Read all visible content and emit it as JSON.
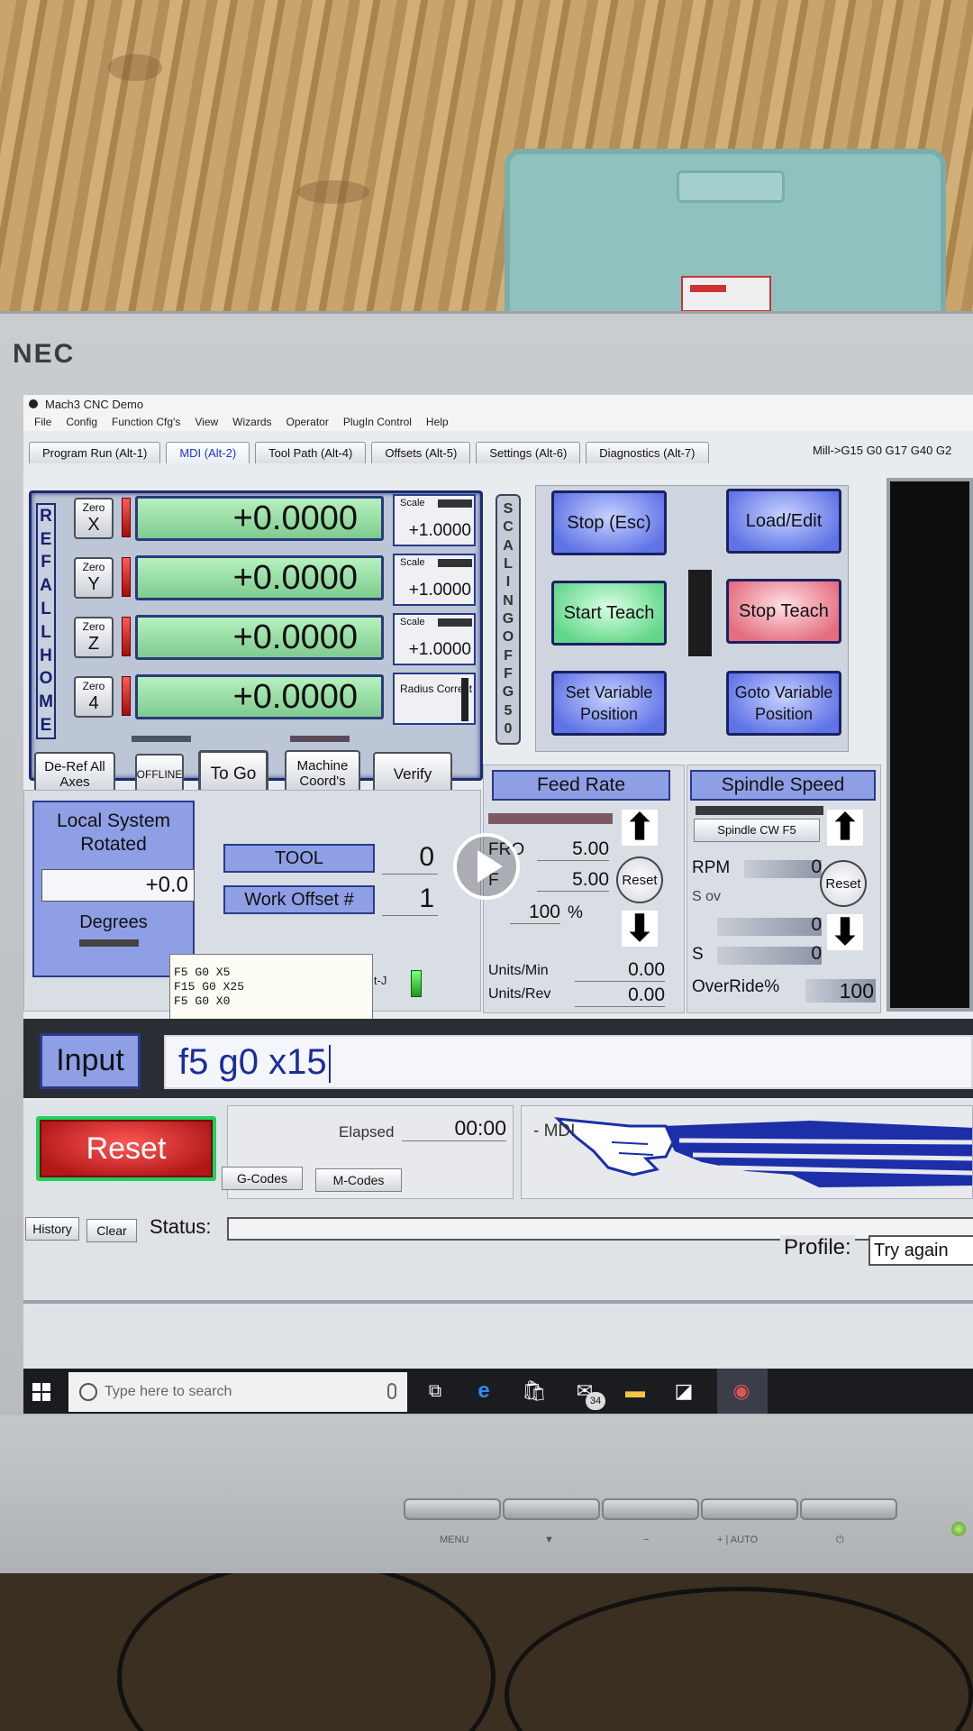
{
  "monitor": {
    "brand": "NEC",
    "hw_labels": [
      "MENU",
      "▼",
      "−",
      "+ | AUTO",
      "⏻"
    ]
  },
  "window": {
    "title": "Mach3 CNC Demo"
  },
  "menu": [
    "File",
    "Config",
    "Function Cfg's",
    "View",
    "Wizards",
    "Operator",
    "PlugIn Control",
    "Help"
  ],
  "tabs": [
    {
      "label": "Program Run (Alt-1)",
      "active": false
    },
    {
      "label": "MDI (Alt-2)",
      "active": true
    },
    {
      "label": "Tool Path (Alt-4)",
      "active": false
    },
    {
      "label": "Offsets (Alt-5)",
      "active": false
    },
    {
      "label": "Settings (Alt-6)",
      "active": false
    },
    {
      "label": "Diagnostics (Alt-7)",
      "active": false
    }
  ],
  "modal_status": "Mill->G15  G0 G17 G40 G2",
  "dro": {
    "ref_all_home": [
      "R",
      "E",
      "F",
      "A",
      "L",
      "L",
      "H",
      "O",
      "M",
      "E"
    ],
    "zero_label": "Zero",
    "axes": [
      {
        "axis": "X",
        "value": "+0.0000",
        "scale_label": "Scale",
        "scale": "+1.0000"
      },
      {
        "axis": "Y",
        "value": "+0.0000",
        "scale_label": "Scale",
        "scale": "+1.0000"
      },
      {
        "axis": "Z",
        "value": "+0.0000",
        "scale_label": "Scale",
        "scale": "+1.0000"
      },
      {
        "axis": "4",
        "value": "+0.0000"
      }
    ],
    "radius_correct": "Radius Correct"
  },
  "buttons_row": {
    "deref": "De-Ref All Axes",
    "offline": "OFFLINE",
    "togo": "To Go",
    "machine": "Machine Coord's",
    "verify": "Verify"
  },
  "scaling_strip": [
    "S",
    "C",
    "A",
    "L",
    "I",
    "N",
    "G",
    "O",
    "F",
    "F",
    "G",
    "5",
    "0"
  ],
  "teach": {
    "stop": "Stop (Esc)",
    "load_edit": "Load/Edit",
    "start_teach": "Start Teach",
    "stop_teach": "Stop Teach",
    "set_var": "Set Variable Position",
    "goto_var": "Goto Variable Position"
  },
  "local_system": {
    "title": "Local System Rotated",
    "value": "+0.0",
    "degrees": "Degrees"
  },
  "tool": {
    "label": "TOOL",
    "value": "0"
  },
  "work_offset": {
    "label": "Work Offset #",
    "value": "1"
  },
  "mdi_history": [
    "F5 G0 X5",
    "F15 G0 X25",
    "F5 G0 X0"
  ],
  "alt_j": "lt-J",
  "feed": {
    "title": "Feed Rate",
    "fro_label": "FRO",
    "fro_value": "5.00",
    "f_label": "F",
    "f_value": "5.00",
    "percent_value": "100",
    "percent_sign": "%",
    "reset": "Reset",
    "units_min_label": "Units/Min",
    "units_min_value": "0.00",
    "units_rev_label": "Units/Rev",
    "units_rev_value": "0.00"
  },
  "spindle": {
    "title": "Spindle Speed",
    "cw_button": "Spindle CW F5",
    "rpm_label": "RPM",
    "rpm_value": "0",
    "sov_label": "S ov",
    "sov_value": "0",
    "s_label": "S",
    "s_value": "0",
    "reset": "Reset",
    "override_label": "OverRide%",
    "override_value": "100"
  },
  "input": {
    "label": "Input",
    "value": "f5 g0 x15"
  },
  "reset_button": "Reset",
  "elapsed": {
    "label": "Elapsed",
    "value": "00:00"
  },
  "gcodes_button": "G-Codes",
  "mcodes_button": "M-Codes",
  "mdi_label": "- MDI",
  "history_button": "History",
  "clear_button": "Clear",
  "status_label": "Status:",
  "profile": {
    "label": "Profile:",
    "value": "Try again"
  },
  "taskbar": {
    "search_placeholder": "Type here to search",
    "mail_badge": "34"
  },
  "colors": {
    "dro_green": "#7fcb8f",
    "panel_blue": "#8f9fe6",
    "reset_red": "#b01818",
    "input_text": "#1a2d9d"
  }
}
